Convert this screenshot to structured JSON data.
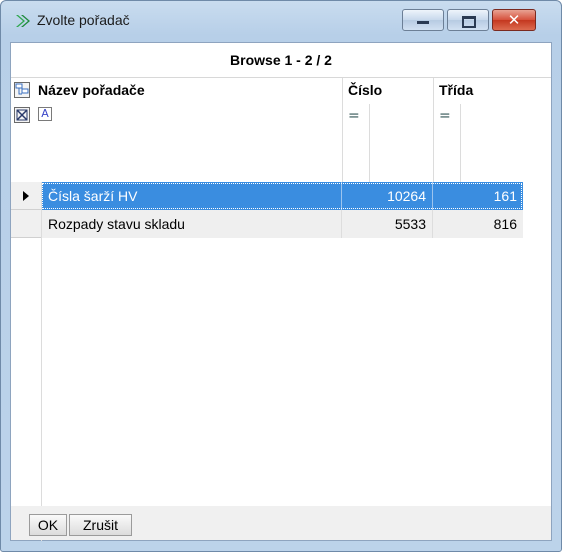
{
  "window": {
    "title": "Zvolte pořadač"
  },
  "browse": {
    "label": "Browse  1 - 2 / 2"
  },
  "columns": {
    "name": "Název pořadače",
    "number": "Číslo",
    "class": "Třída"
  },
  "filter": {
    "text_icon_glyph": "A",
    "eq_number": "=",
    "eq_class": "="
  },
  "rows": [
    {
      "name": "Čísla šarží HV",
      "number": "10264",
      "class": "161",
      "selected": true
    },
    {
      "name": "Rozpady stavu skladu",
      "number": "5533",
      "class": "816",
      "selected": false
    }
  ],
  "buttons": {
    "ok": "OK",
    "cancel": "Zrušit"
  },
  "colors": {
    "selection": "#3a8de0",
    "close_button": "#d6503b",
    "app_icon": "#2fa84f"
  }
}
